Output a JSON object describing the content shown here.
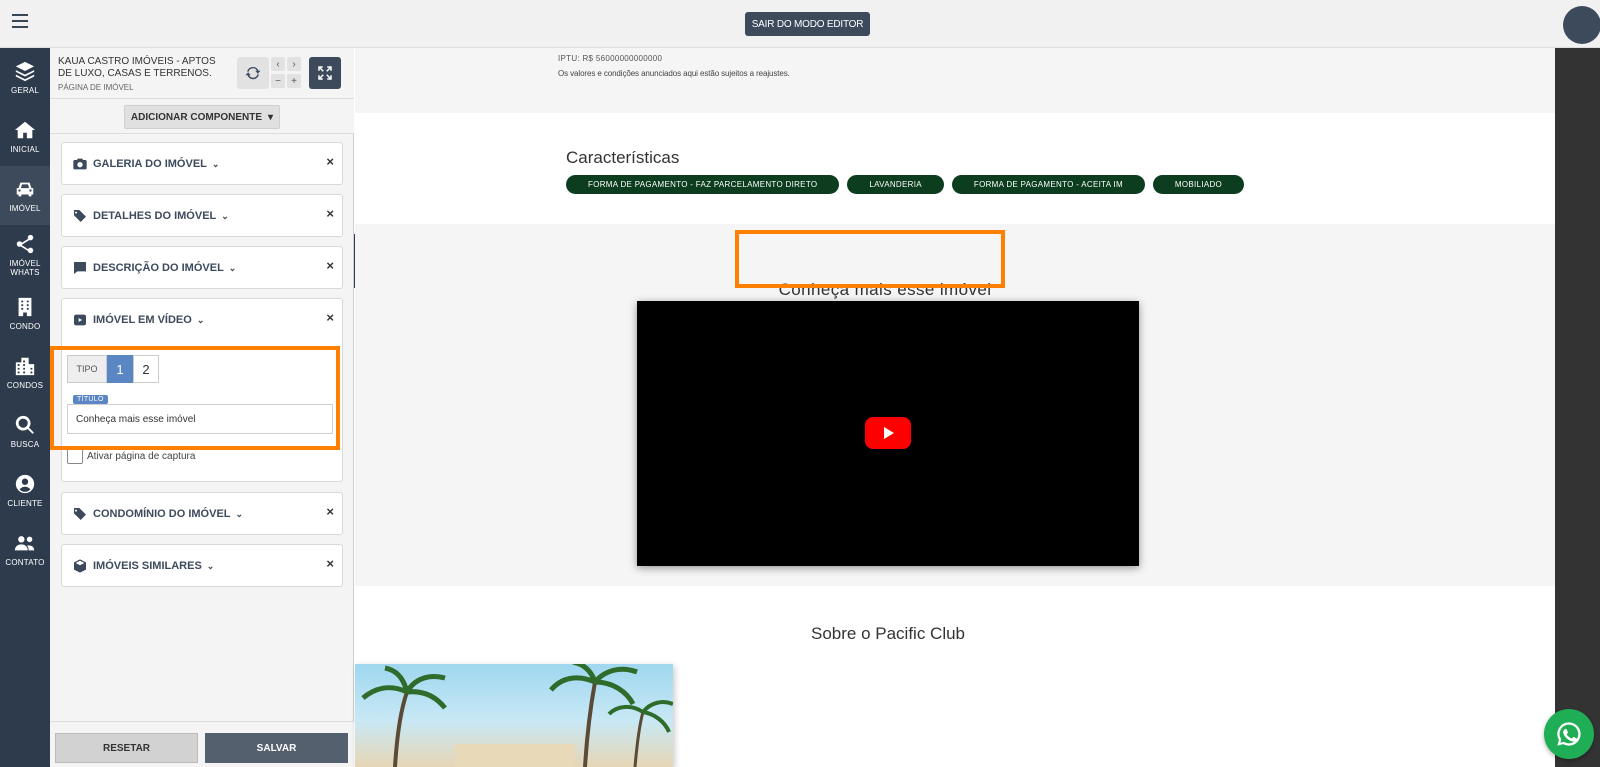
{
  "topbar": {
    "exit_editor_label": "SAIR DO MODO EDITOR"
  },
  "nav": {
    "items": [
      {
        "label": "GERAL",
        "icon": "layers-icon"
      },
      {
        "label": "INICIAL",
        "icon": "home-icon"
      },
      {
        "label": "IMÓVEL",
        "icon": "car-icon"
      },
      {
        "label": "IMÓVEL WHATS",
        "icon": "share-icon"
      },
      {
        "label": "CONDO",
        "icon": "building-icon"
      },
      {
        "label": "CONDOS",
        "icon": "city-icon"
      },
      {
        "label": "BUSCA",
        "icon": "search-icon"
      },
      {
        "label": "CLIENTE",
        "icon": "user-circle-icon"
      },
      {
        "label": "CONTATO",
        "icon": "users-icon"
      }
    ],
    "active_item": "IMÓVEL"
  },
  "panel": {
    "site_name": "KAUA CASTRO IMÓVEIS - APTOS DE LUXO, CASAS E TERRENOS.",
    "page_name": "PÁGINA DE IMÓVEL",
    "add_component_label": "ADICIONAR COMPONENTE",
    "components": [
      {
        "title": "GALERIA DO IMÓVEL",
        "icon": "camera-icon"
      },
      {
        "title": "DETALHES DO IMÓVEL",
        "icon": "tags-icon"
      },
      {
        "title": "DESCRIÇÃO DO IMÓVEL",
        "icon": "comment-icon"
      },
      {
        "title": "IMÓVEL EM VÍDEO",
        "icon": "youtube-icon"
      },
      {
        "title": "CONDOMÍNIO DO IMÓVEL",
        "icon": "tags-icon"
      },
      {
        "title": "IMÓVEIS SIMILARES",
        "icon": "cube-icon"
      }
    ],
    "video_settings": {
      "tipo_label": "TIPO",
      "tipo_options": [
        "1",
        "2"
      ],
      "tipo_selected": "1",
      "title_tag": "TÍTULO",
      "title_value": "Conheça mais esse imóvel",
      "capture_label": "Ativar página de captura"
    },
    "reset_label": "RESETAR",
    "save_label": "SALVAR"
  },
  "content": {
    "iptu": "IPTU: R$ 56000000000000",
    "disclaimer": "Os valores e condições anunciados aqui estão sujeitos a reajustes.",
    "characteristics_title": "Características",
    "characteristics": [
      "FORMA DE PAGAMENTO - FAZ PARCELAMENTO DIRETO",
      "LAVANDERIA",
      "FORMA DE PAGAMENTO - ACEITA IM",
      "MOBILIADO"
    ],
    "video_section_title": "Conheça mais esse imóvel",
    "about_title": "Sobre o Pacific Club"
  },
  "colors": {
    "nav_bg": "#2e3b4c",
    "accent_blue": "#5a87c4",
    "highlight_orange": "#ff8000",
    "pill_green": "#0b3d1e",
    "whatsapp_green": "#1fae55"
  }
}
